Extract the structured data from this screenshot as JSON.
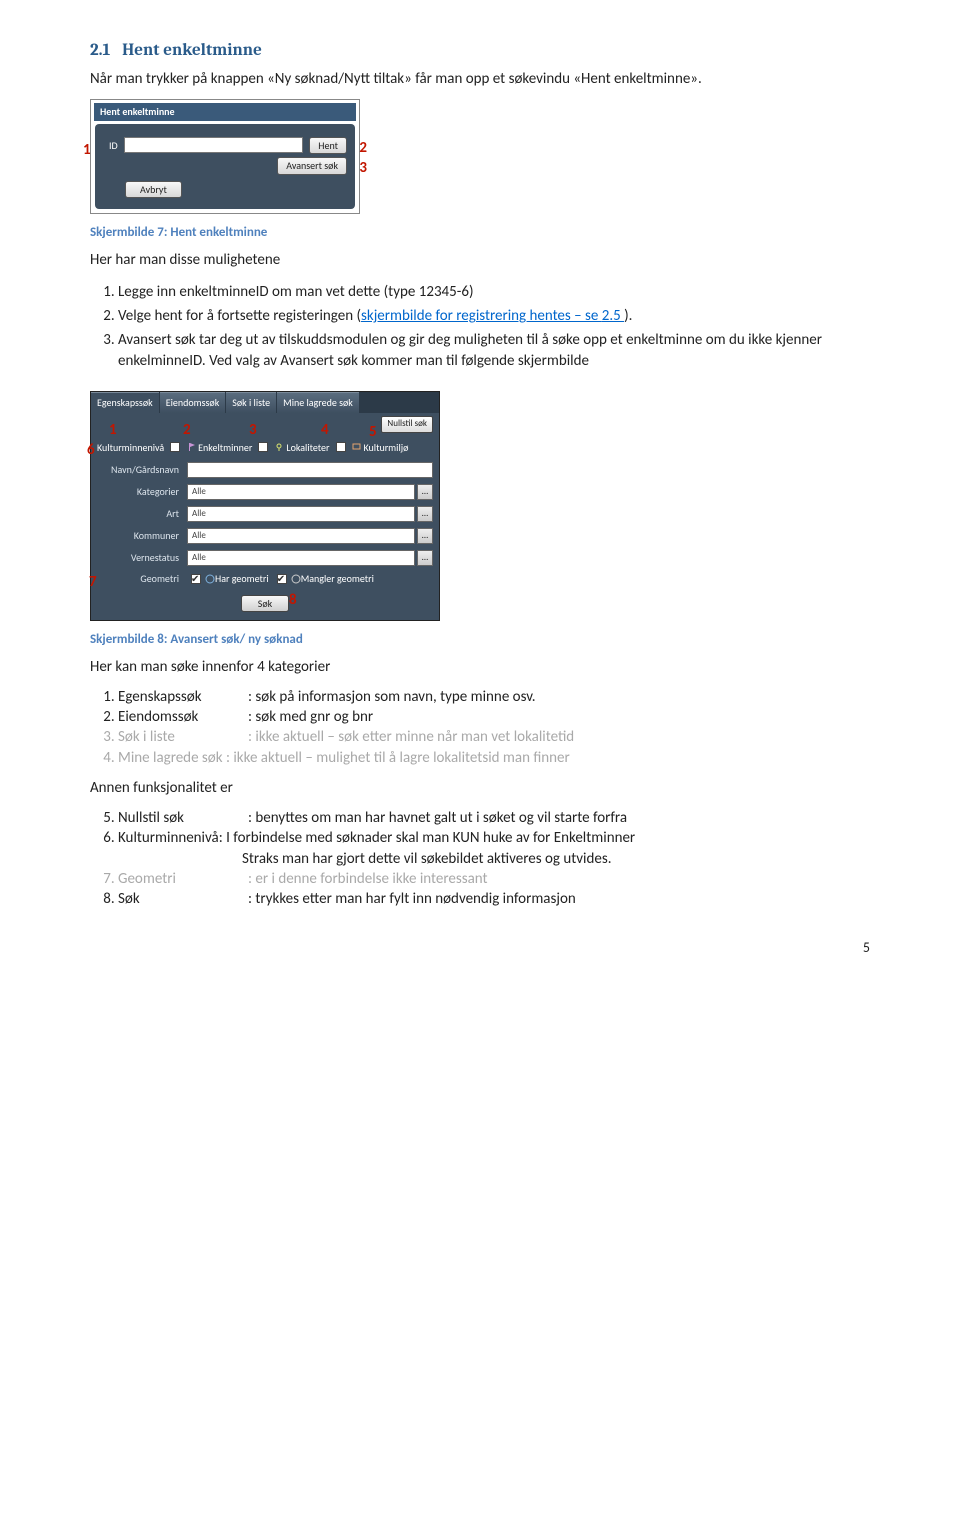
{
  "heading": {
    "number": "2.1",
    "title": "Hent enkeltminne"
  },
  "intro": "Når man trykker på knappen «Ny søknad/Nytt tiltak» får man opp et søkevindu «Hent enkeltminne».",
  "shot1": {
    "windowTitle": "Hent enkeltminne",
    "idLabel": "ID",
    "hentBtn": "Hent",
    "avansertBtn": "Avansert søk",
    "avbrytBtn": "Avbryt",
    "ann1": "1",
    "ann2": "2",
    "ann3": "3"
  },
  "caption1": "Skjermbilde 7: Hent enkeltminne",
  "lead1": "Her har man disse mulighetene",
  "list1": {
    "i1_pre": "Legge inn enkeltminneID om man vet dette (type 12345-6)",
    "i2_pre": "Velge hent for å fortsette registeringen (",
    "i2_link": "skjermbilde for registrering hentes – se ",
    "i2_link2": "2.5 ",
    "i2_post": ").",
    "i3": "Avansert søk tar deg ut av tilskuddsmodulen og gir deg muligheten til å søke opp et enkeltminne om du ikke kjenner enkelminneID. Ved valg av Avansert søk kommer man til følgende skjermbilde"
  },
  "shot2": {
    "tabs": [
      "Egenskapssøk",
      "Eiendomssøk",
      "Søk i liste",
      "Mine lagrede søk"
    ],
    "nullstill": "Nullstil søk",
    "lvlLabel": "Kulturminnenivå",
    "lvlEnk": "Enkeltminner",
    "lvlLok": "Lokaliteter",
    "lvlKul": "Kulturmiljø",
    "rows": {
      "navn": "Navn/Gårdsnavn",
      "kat": "Kategorier",
      "katv": "Alle",
      "art": "Art",
      "artv": "Alle",
      "kom": "Kommuner",
      "komv": "Alle",
      "ver": "Vernestatus",
      "verv": "Alle",
      "geo": "Geometri",
      "geoHar": "Har geometri",
      "geoMangler": "Mangler geometri"
    },
    "sok": "Søk",
    "ann": {
      "a1": "1",
      "a2": "2",
      "a3": "3",
      "a4": "4",
      "a5": "5",
      "a6": "6",
      "a7": "7",
      "a8": "8"
    }
  },
  "caption2": "Skjermbilde 8: Avansert søk/ ny søknad",
  "lead2": "Her kan man søke innenfor 4 kategorier",
  "list2": {
    "i1": {
      "t": "Egenskapssøk",
      "d": ": søk på informasjon som navn, type minne osv."
    },
    "i2": {
      "t": "Eiendomssøk",
      "d": ": søk med gnr og bnr"
    },
    "i3": {
      "t": "Søk i liste",
      "d": ": ikke aktuell – søk etter minne når man vet lokalitetid"
    },
    "i4": {
      "t": "Mine lagrede søk",
      "d": ": ikke aktuell – mulighet til å lagre lokalitetsid man finner"
    }
  },
  "lead3": "Annen funksjonalitet er",
  "list3": {
    "i5": {
      "t": "Nullstil søk",
      "d": ": benyttes om man har havnet galt ut i søket og vil starte forfra"
    },
    "i6_a": "Kulturminnenivå: I forbindelse med søknader skal man KUN huke av for Enkeltminner",
    "i6_b": "Straks man har gjort dette vil søkebildet aktiveres og utvides.",
    "i7": {
      "t": "Geometri",
      "d": ": er i denne forbindelse ikke interessant"
    },
    "i8": {
      "t": "Søk",
      "d": ": trykkes etter man har fylt inn nødvendig informasjon"
    }
  },
  "pagenum": "5"
}
